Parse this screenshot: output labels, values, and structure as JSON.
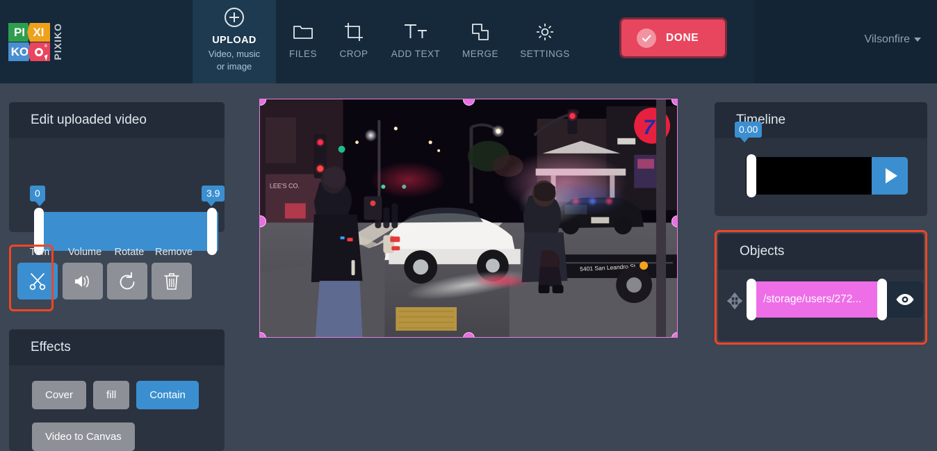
{
  "colors": {
    "header_bg": "#15293a",
    "page_bg": "#3d4654",
    "panel_bg": "#2b3340",
    "panel_head_bg": "#232b38",
    "accent_blue": "#3b8fd0",
    "accent_red": "#e8455e",
    "highlight_red": "#ef4623",
    "object_magenta": "#ee6ee8",
    "muted_button": "#8d9197"
  },
  "header": {
    "logo": {
      "cells": [
        "PI",
        "XI",
        "KO"
      ],
      "wordmark": "PIXIKO",
      "registered": "®"
    },
    "upload": {
      "icon": "plus-circle-icon",
      "label": "UPLOAD",
      "sublabel_line1": "Video, music",
      "sublabel_line2": "or image"
    },
    "tools": [
      {
        "label": "FILES",
        "icon": "folder-icon"
      },
      {
        "label": "CROP",
        "icon": "crop-icon"
      },
      {
        "label": "ADD TEXT",
        "icon": "text-size-icon"
      },
      {
        "label": "MERGE",
        "icon": "merge-shapes-icon"
      },
      {
        "label": "SETTINGS",
        "icon": "gear-icon"
      }
    ],
    "done_button": {
      "label": "DONE",
      "icon": "check-circle-icon"
    },
    "user_menu": {
      "label": "Vilsonfire",
      "icon": "chevron-down-icon"
    }
  },
  "left_panel": {
    "edit_card": {
      "title": "Edit uploaded video",
      "trim_range": {
        "start_value": "0",
        "end_value": "3.9",
        "min": 0,
        "max": 3.9
      }
    },
    "tools": [
      {
        "label": "Trim",
        "icon": "scissors-icon",
        "active": true,
        "highlighted": true
      },
      {
        "label": "Volume",
        "icon": "speaker-icon",
        "active": false,
        "highlighted": false
      },
      {
        "label": "Rotate",
        "icon": "rotate-left-icon",
        "active": false,
        "highlighted": false
      },
      {
        "label": "Remove",
        "icon": "trash-icon",
        "active": false,
        "highlighted": false
      }
    ],
    "effects_card": {
      "title": "Effects",
      "fit_options": [
        {
          "label": "Cover",
          "active": false
        },
        {
          "label": "fill",
          "active": false
        },
        {
          "label": "Contain",
          "active": true
        }
      ],
      "secondary_button": "Video to Canvas"
    }
  },
  "preview": {
    "name": "video-preview-canvas",
    "selection_handles": 8,
    "scene_text": {
      "truck_side": "5401 San Leandro St.",
      "store_sign": "LEE'S CO."
    }
  },
  "right_panel": {
    "timeline_card": {
      "title": "Timeline",
      "playhead_value": "0.00",
      "play_button_icon": "play-icon"
    },
    "objects_card": {
      "title": "Objects",
      "highlighted": true,
      "items": [
        {
          "label": "/storage/users/272...",
          "move_icon": "move-arrows-icon",
          "visibility_icon": "eye-icon",
          "color": "#ee6ee8"
        }
      ]
    }
  }
}
